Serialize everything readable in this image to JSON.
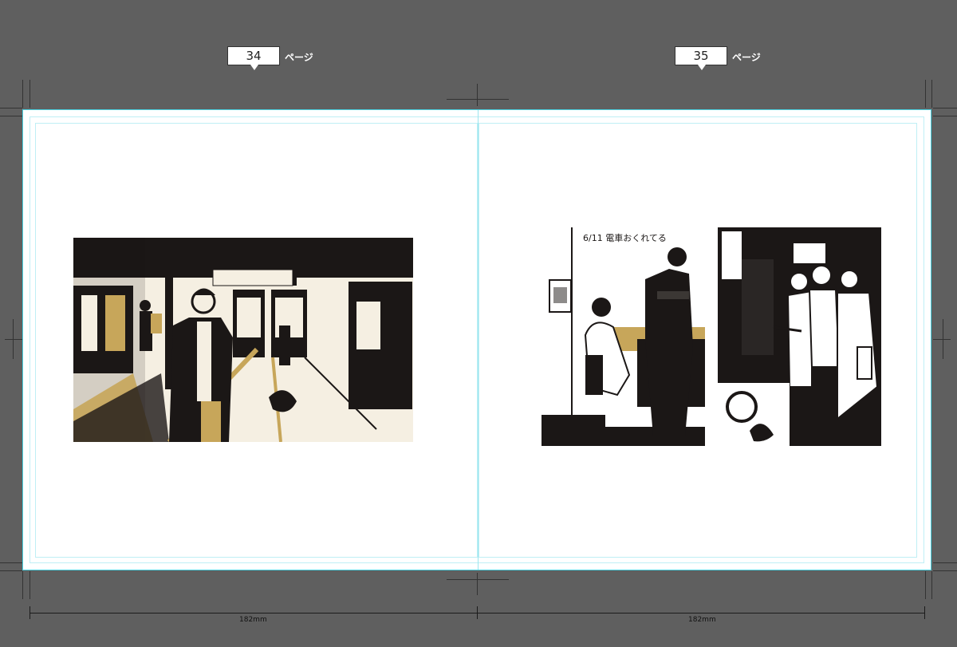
{
  "pages": {
    "left": {
      "number": "34",
      "suffix": "ページ"
    },
    "right": {
      "number": "35",
      "suffix": "ページ"
    }
  },
  "dimensions": {
    "left_width": "182mm",
    "right_width": "182mm"
  },
  "artwork": {
    "left_image": "station-platform-illustration",
    "right_image_1": "waiting-passengers-illustration",
    "right_image_2": "crowd-illustration",
    "handwritten_note": "6/11 電車おくれてる"
  },
  "colors": {
    "workspace": "#5f5f5f",
    "guide": "#4ad1e0",
    "ink": "#1b1716",
    "paper": "#f5efe2",
    "ochre": "#c7a65a"
  }
}
